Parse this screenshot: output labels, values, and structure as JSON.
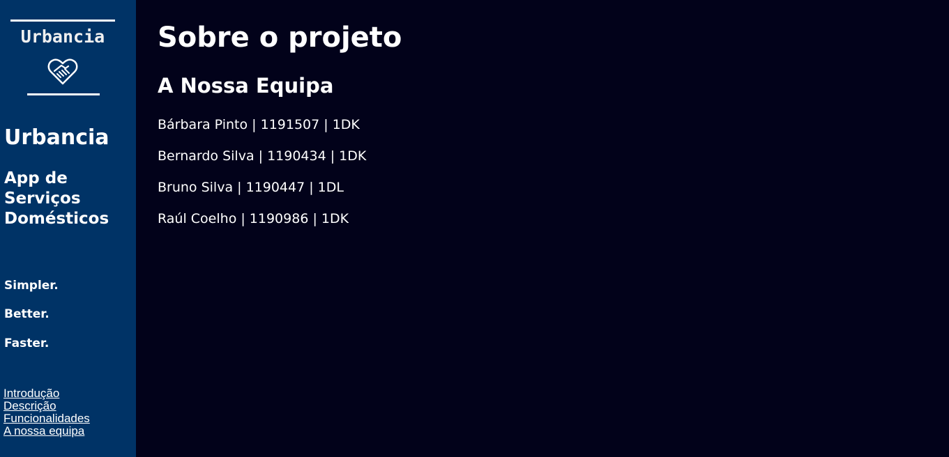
{
  "sidebar": {
    "logo_text": "Urbancia",
    "logo_icon": "handshake-heart-icon",
    "title": "Urbancia",
    "subtitle_lines": [
      "App de",
      "Serviços",
      "Domésticos"
    ],
    "slogans": [
      "Simpler.",
      "Better.",
      "Faster."
    ],
    "nav": [
      "Introdução",
      "Descrição",
      "Funcionalidades",
      "A nossa equipa"
    ]
  },
  "main": {
    "title": "Sobre o projeto",
    "section_title": "A Nossa Equipa",
    "members": [
      "Bárbara Pinto | 1191507 | 1DK",
      "Bernardo Silva | 1190434 | 1DK",
      "Bruno Silva | 1190447 | 1DL",
      "Raúl Coelho | 1190986 | 1DK"
    ]
  },
  "colors": {
    "sidebar_bg": "#003366",
    "main_bg": "#02021a",
    "text": "#ffffff"
  }
}
